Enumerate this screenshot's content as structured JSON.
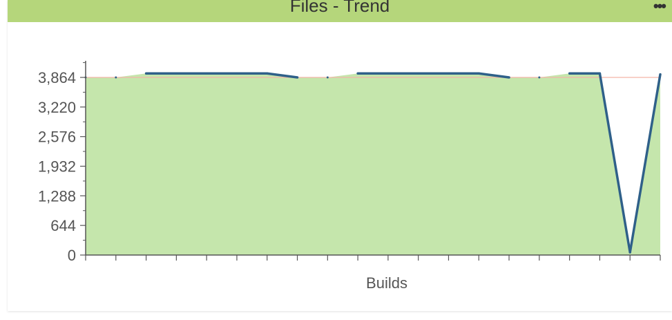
{
  "panel": {
    "title": "Files - Trend",
    "menu_label": "•••"
  },
  "colors": {
    "header": "#b5d67b",
    "area_fill": "#c5e6ac",
    "line": "#2f6089",
    "baseline": "#f3b5a8",
    "axis": "#555555"
  },
  "chart_data": {
    "type": "area",
    "title": "Files - Trend",
    "xlabel": "Builds",
    "ylabel": "",
    "x": [
      0,
      1,
      2,
      3,
      4,
      5,
      6,
      7,
      8,
      9,
      10,
      11,
      12,
      13,
      14,
      15,
      16,
      17,
      18,
      19
    ],
    "ylim": [
      0,
      4200
    ],
    "yticks": [
      0,
      644,
      1288,
      1932,
      2576,
      3220,
      3864
    ],
    "ytick_labels": [
      "0",
      "644",
      "1,288",
      "1,932",
      "2,576",
      "3,220",
      "3,864"
    ],
    "series": [
      {
        "values": [
          3864,
          3864,
          3950,
          3950,
          3950,
          3950,
          3950,
          3864,
          3864,
          3950,
          3950,
          3950,
          3950,
          3950,
          3864,
          3864,
          3950,
          3950,
          60,
          3930
        ]
      }
    ],
    "baseline_value": 3864,
    "grid": false,
    "legend": "none"
  }
}
